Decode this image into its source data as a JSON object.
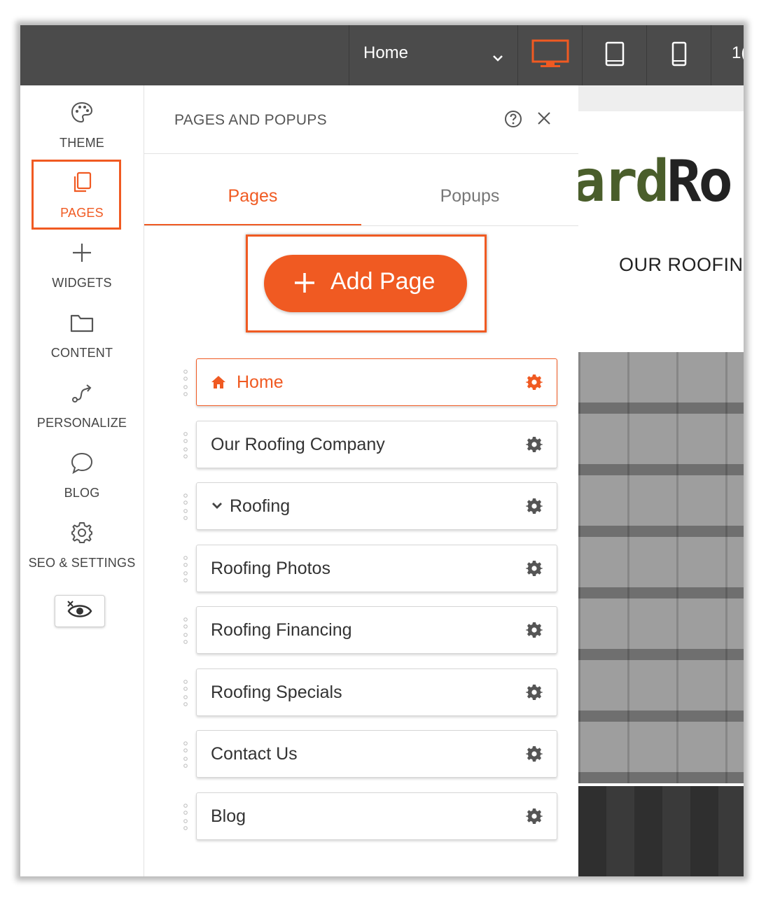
{
  "topbar": {
    "page_select_value": "Home",
    "zoom_text": "1("
  },
  "leftnav": {
    "items": [
      {
        "label": "THEME",
        "icon": "palette-icon"
      },
      {
        "label": "PAGES",
        "icon": "pages-icon"
      },
      {
        "label": "WIDGETS",
        "icon": "plus-icon"
      },
      {
        "label": "CONTENT",
        "icon": "folder-icon"
      },
      {
        "label": "PERSONALIZE",
        "icon": "route-icon"
      },
      {
        "label": "BLOG",
        "icon": "chat-bubble-icon"
      },
      {
        "label": "SEO & SETTINGS",
        "icon": "gear-icon"
      }
    ]
  },
  "panel": {
    "title": "PAGES AND POPUPS",
    "tabs": [
      "Pages",
      "Popups"
    ],
    "add_button_label": "Add Page",
    "pages": [
      "Home",
      "Our Roofing Company",
      "Roofing",
      "Roofing Photos",
      "Roofing Financing",
      "Roofing Specials",
      "Contact Us",
      "Blog"
    ]
  },
  "preview": {
    "logo_part_green": "ard",
    "logo_part_dark": "Ro",
    "nav_text": "OUR ROOFIN"
  },
  "colors": {
    "accent": "#f05a22",
    "topbar": "#4b4b4b"
  }
}
